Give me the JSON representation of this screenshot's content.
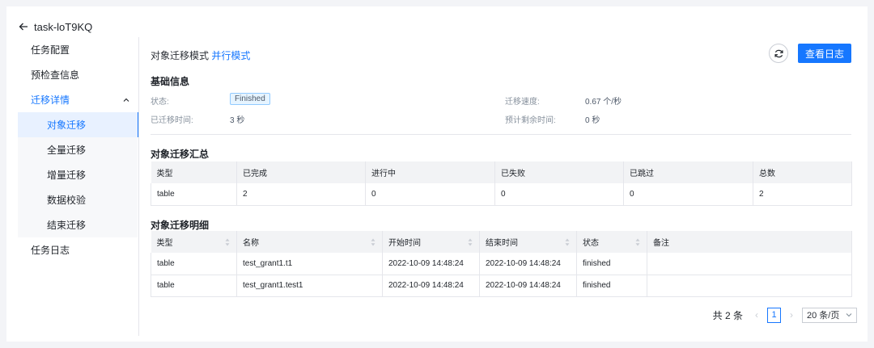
{
  "header": {
    "back_title": "task-loT9KQ"
  },
  "sidebar": {
    "items": [
      {
        "label": "任务配置"
      },
      {
        "label": "预检查信息"
      },
      {
        "label": "迁移详情"
      },
      {
        "label": "对象迁移"
      },
      {
        "label": "全量迁移"
      },
      {
        "label": "增量迁移"
      },
      {
        "label": "数据校验"
      },
      {
        "label": "结束迁移"
      },
      {
        "label": "任务日志"
      }
    ]
  },
  "main": {
    "mode_label": "对象迁移模式",
    "mode_value": "并行模式",
    "log_button": "查看日志",
    "basic": {
      "title": "基础信息",
      "status_label": "状态:",
      "status_value": "Finished",
      "speed_label": "迁移速度:",
      "speed_value": "0.67 个/秒",
      "elapsed_label": "已迁移时间:",
      "elapsed_value": "3 秒",
      "remain_label": "预计剩余时间:",
      "remain_value": "0 秒"
    },
    "summary": {
      "title": "对象迁移汇总",
      "columns": [
        "类型",
        "已完成",
        "进行中",
        "已失败",
        "已跳过",
        "总数"
      ],
      "rows": [
        [
          "table",
          "2",
          "0",
          "0",
          "0",
          "2"
        ]
      ]
    },
    "detail": {
      "title": "对象迁移明细",
      "columns": [
        "类型",
        "名称",
        "开始时间",
        "结束时间",
        "状态",
        "备注"
      ],
      "rows": [
        [
          "table",
          "test_grant1.t1",
          "2022-10-09 14:48:24",
          "2022-10-09 14:48:24",
          "finished",
          ""
        ],
        [
          "table",
          "test_grant1.test1",
          "2022-10-09 14:48:24",
          "2022-10-09 14:48:24",
          "finished",
          ""
        ]
      ]
    },
    "pager": {
      "total": "共 2 条",
      "current": "1",
      "size": "20 条/页"
    }
  }
}
